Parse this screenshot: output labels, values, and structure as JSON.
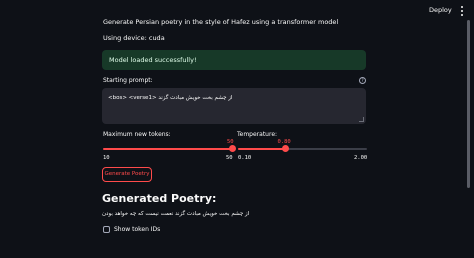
{
  "header": {
    "deploy_label": "Deploy",
    "menu_icon": "kebab-menu-icon"
  },
  "main": {
    "title_text": "Generate Persian poetry in the style of Hafez using a transformer model",
    "device_text": "Using device: cuda",
    "success_message": "Model loaded successfully!",
    "prompt": {
      "label": "Starting prompt:",
      "value_prefix": "<bos> <verse1>",
      "value_text": "از چشم بخت خویش مبادت گزند"
    },
    "max_tokens": {
      "label": "Maximum new tokens:",
      "value": "50",
      "min": "10",
      "max": "50",
      "fraction": 1.0
    },
    "temperature": {
      "label": "Temperature:",
      "value": "0.80",
      "min": "0.10",
      "max": "2.00",
      "fraction": 0.368
    },
    "generate_button_label": "Generate Poetry",
    "output_heading": "Generated Poetry:",
    "output_text": "از چشم بخت خویش مبادت گزند نعمت نیست که چه خواهد بودن",
    "show_ids_label": "Show token IDs"
  },
  "colors": {
    "background": "#0e1117",
    "accent": "#ff4b4b",
    "success_bg": "#173928",
    "input_bg": "#262730"
  }
}
